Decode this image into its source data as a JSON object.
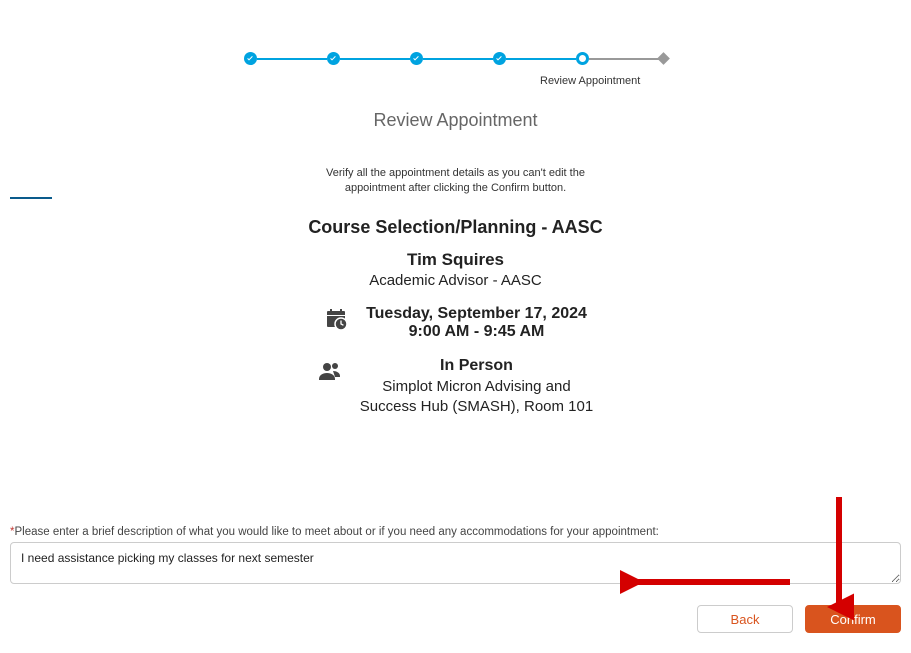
{
  "stepper": {
    "current_label": "Review Appointment"
  },
  "page": {
    "title": "Review Appointment",
    "verify_line1": "Verify all the appointment details as you can't edit the",
    "verify_line2": "appointment after clicking the Confirm button."
  },
  "appointment": {
    "topic": "Course Selection/Planning - AASC",
    "advisor_name": "Tim Squires",
    "advisor_role": "Academic Advisor - AASC",
    "date": "Tuesday, September 17, 2024",
    "time": "9:00 AM - 9:45 AM",
    "mode": "In Person",
    "location_line1": "Simplot Micron Advising and",
    "location_line2": "Success Hub (SMASH), Room 101"
  },
  "form": {
    "label": "Please enter a brief description of what you would like to meet about or if you need any accommodations for your appointment:",
    "value": "I need assistance picking my classes for next semester"
  },
  "buttons": {
    "back": "Back",
    "confirm": "Confirm"
  }
}
